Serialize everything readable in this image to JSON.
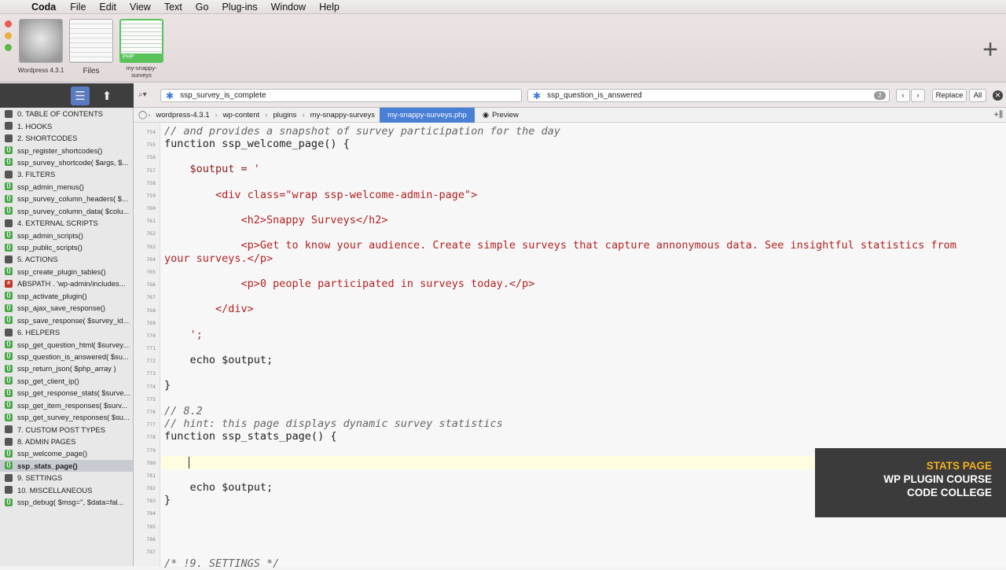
{
  "menubar": {
    "items": [
      "Coda",
      "File",
      "Edit",
      "View",
      "Text",
      "Go",
      "Plug-ins",
      "Window",
      "Help"
    ]
  },
  "sites": [
    {
      "label": "Wordpress 4.3.1"
    },
    {
      "label": "Files"
    },
    {
      "label": "my-snappy-surveys",
      "badge": "PHP"
    }
  ],
  "toolbar": {
    "search_value": "ssp_survey_is_complete",
    "replace_value": "ssp_question_is_answered",
    "match_count": "2",
    "replace_label": "Replace",
    "all_label": "All"
  },
  "pathbar": {
    "crumbs": [
      "wordpress-4.3.1",
      "wp-content",
      "plugins",
      "my-snappy-surveys",
      "my-snappy-surveys.php"
    ],
    "preview_label": "Preview"
  },
  "sidebar": {
    "items": [
      {
        "label": "0. TABLE OF CONTENTS",
        "type": "sec"
      },
      {
        "label": "1. HOOKS",
        "type": "sec"
      },
      {
        "label": "2. SHORTCODES",
        "type": "sec"
      },
      {
        "label": "ssp_register_shortcodes()",
        "type": "fn"
      },
      {
        "label": "ssp_survey_shortcode( $args, $...",
        "type": "fn"
      },
      {
        "label": "3. FILTERS",
        "type": "sec"
      },
      {
        "label": "ssp_admin_menus()",
        "type": "fn"
      },
      {
        "label": "ssp_survey_column_headers( $...",
        "type": "fn"
      },
      {
        "label": "ssp_survey_column_data( $colu...",
        "type": "fn"
      },
      {
        "label": "4. EXTERNAL SCRIPTS",
        "type": "sec"
      },
      {
        "label": "ssp_admin_scripts()",
        "type": "fn"
      },
      {
        "label": "ssp_public_scripts()",
        "type": "fn"
      },
      {
        "label": "5. ACTIONS",
        "type": "sec"
      },
      {
        "label": "ssp_create_plugin_tables()",
        "type": "fn"
      },
      {
        "label": "ABSPATH . 'wp-admin/includes...",
        "type": "cst"
      },
      {
        "label": "ssp_activate_plugin()",
        "type": "fn"
      },
      {
        "label": "ssp_ajax_save_response()",
        "type": "fn"
      },
      {
        "label": "ssp_save_response( $survey_id...",
        "type": "fn"
      },
      {
        "label": "6. HELPERS",
        "type": "sec"
      },
      {
        "label": "ssp_get_question_html( $survey...",
        "type": "fn"
      },
      {
        "label": "ssp_question_is_answered( $su...",
        "type": "fn"
      },
      {
        "label": "ssp_return_json( $php_array )",
        "type": "fn"
      },
      {
        "label": "ssp_get_client_ip()",
        "type": "fn"
      },
      {
        "label": "ssp_get_response_stats( $surve...",
        "type": "fn"
      },
      {
        "label": "ssp_get_item_responses( $surv...",
        "type": "fn"
      },
      {
        "label": "ssp_get_survey_responses( $su...",
        "type": "fn"
      },
      {
        "label": "7. CUSTOM POST TYPES",
        "type": "sec"
      },
      {
        "label": "8. ADMIN PAGES",
        "type": "sec"
      },
      {
        "label": "ssp_welcome_page()",
        "type": "fn"
      },
      {
        "label": "ssp_stats_page()",
        "type": "fn",
        "selected": true
      },
      {
        "label": "9. SETTINGS",
        "type": "sec"
      },
      {
        "label": "10. MISCELLANEOUS",
        "type": "sec"
      },
      {
        "label": "ssp_debug( $msg='', $data=fal...",
        "type": "fn"
      }
    ]
  },
  "code": {
    "line_numbers": [
      "754",
      "755",
      "756",
      "757",
      "758",
      "759",
      "760",
      "761",
      "762",
      "763",
      "764",
      "765",
      "766",
      "767",
      "768",
      "769",
      "770",
      "771",
      "772",
      "773",
      "774",
      "775",
      "776",
      "777",
      "778",
      "779",
      "780",
      "781",
      "782",
      "783",
      "784",
      "785",
      "786",
      "787"
    ],
    "lines": [
      "// and provides a snapshot of survey participation for the day",
      "function ssp_welcome_page() {",
      "    $output = '",
      "        <div class=\"wrap ssp-welcome-admin-page\">",
      "            <h2>Snappy Surveys</h2>",
      "            <p>Get to know your audience. Create simple surveys that capture annonymous data. See insightful statistics from",
      "your surveys.</p>",
      "            <p>0 people participated in surveys today.</p>",
      "        </div>",
      "    ';",
      "    echo $output;",
      "}",
      "// 8.2",
      "// hint: this page displays dynamic survey statistics",
      "function ssp_stats_page() {",
      "    echo $output;",
      "}",
      "/* !9. SETTINGS */"
    ]
  },
  "overlay": {
    "line1": "STATS PAGE",
    "line2": "WP PLUGIN COURSE",
    "line3": "CODE COLLEGE"
  }
}
